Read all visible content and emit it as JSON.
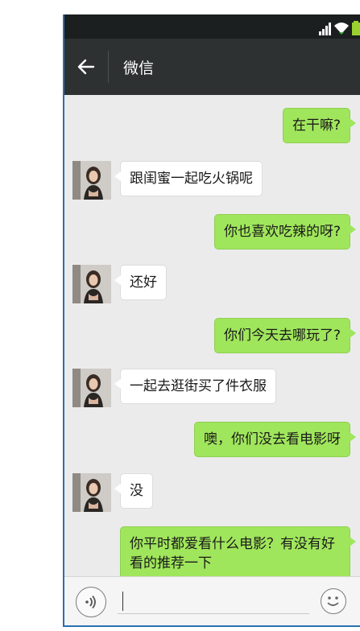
{
  "app": {
    "title": "微信"
  },
  "messages": [
    {
      "side": "right",
      "text": "在干嘛?"
    },
    {
      "side": "left",
      "text": "跟闺蜜一起吃火锅呢"
    },
    {
      "side": "right",
      "text": "你也喜欢吃辣的呀?"
    },
    {
      "side": "left",
      "text": "还好"
    },
    {
      "side": "right",
      "text": "你们今天去哪玩了?"
    },
    {
      "side": "left",
      "text": "一起去逛街买了件衣服"
    },
    {
      "side": "right",
      "text": "噢，你们没去看电影呀"
    },
    {
      "side": "left",
      "text": "没"
    },
    {
      "side": "right",
      "text": "你平时都爱看什么电影？有没有好看的推荐一下"
    }
  ],
  "input": {
    "value": ""
  },
  "colors": {
    "nav_bg": "#2e3132",
    "chat_bg": "#ebebeb",
    "sent_bubble": "#a0e65c",
    "received_bubble": "#ffffff"
  },
  "icons": {
    "back": "back-arrow-icon",
    "signal": "signal-icon",
    "wifi": "wifi-icon",
    "battery": "battery-icon",
    "voice": "voice-icon",
    "emoji": "emoji-icon"
  }
}
